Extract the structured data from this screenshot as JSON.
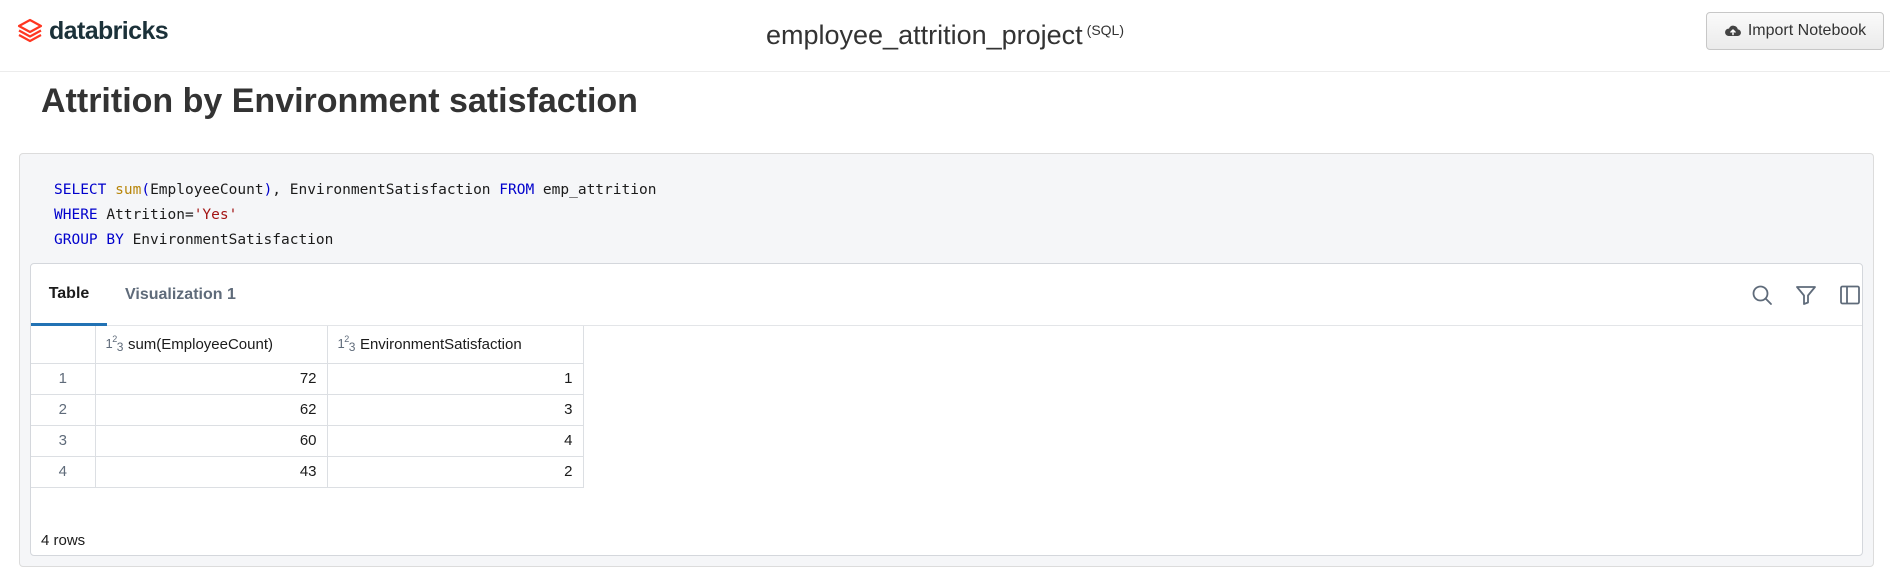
{
  "header": {
    "logo_text": "databricks",
    "notebook_name": "employee_attrition_project",
    "notebook_language": "(SQL)",
    "import_button_label": "Import Notebook"
  },
  "section_title": "Attrition by Environment satisfaction",
  "cell": {
    "code_lines": [
      "SELECT sum(EmployeeCount), EnvironmentSatisfaction FROM emp_attrition",
      "WHERE Attrition='Yes'",
      "GROUP BY EnvironmentSatisfaction"
    ]
  },
  "results": {
    "tabs": [
      {
        "label": "Table",
        "active": true
      },
      {
        "label": "Visualization 1",
        "active": false
      }
    ],
    "toolbar_icons": [
      "search-icon",
      "filter-icon",
      "sidebar-panel-icon"
    ],
    "columns": [
      {
        "type_icon": "123",
        "label": "sum(EmployeeCount)"
      },
      {
        "type_icon": "123",
        "label": "EnvironmentSatisfaction"
      }
    ],
    "rows": [
      {
        "index": "1",
        "cells": [
          "72",
          "1"
        ]
      },
      {
        "index": "2",
        "cells": [
          "62",
          "3"
        ]
      },
      {
        "index": "3",
        "cells": [
          "60",
          "4"
        ]
      },
      {
        "index": "4",
        "cells": [
          "43",
          "2"
        ]
      }
    ],
    "row_count_label": "4 rows"
  },
  "colors": {
    "brand_red": "#ff3621",
    "active_tab_underline": "#2272b4",
    "sql_keyword": "#0000cc",
    "sql_function": "#b8860b",
    "sql_string": "#a31515"
  }
}
